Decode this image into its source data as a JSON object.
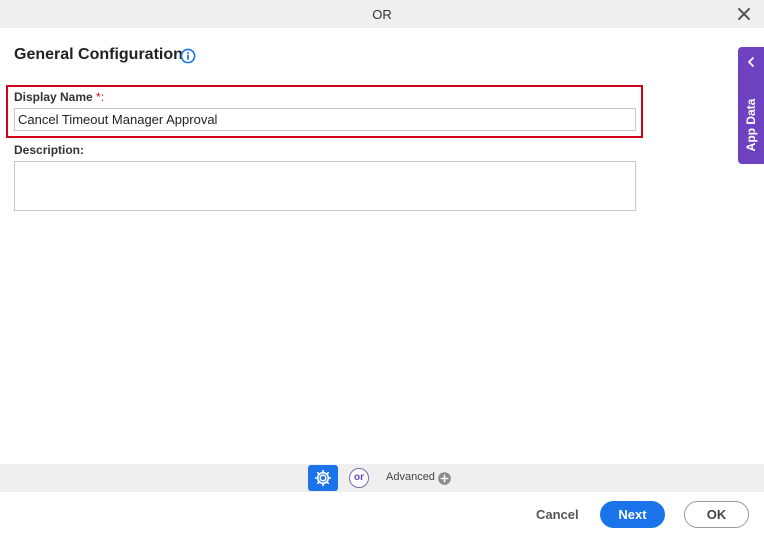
{
  "window": {
    "title": "OR"
  },
  "form": {
    "heading": "General Configuration",
    "display_name": {
      "label": "Display Name",
      "required_mark": "*:",
      "value": "Cancel Timeout Manager Approval"
    },
    "description": {
      "label": "Description:",
      "value": ""
    }
  },
  "side_panel": {
    "label": "App Data"
  },
  "bottom_tabs": {
    "or_label": "or",
    "advanced_label": "Advanced"
  },
  "footer": {
    "cancel_label": "Cancel",
    "next_label": "Next",
    "ok_label": "OK"
  },
  "colors": {
    "primary": "#1a73e8",
    "accent": "#6f42c1",
    "highlight": "#d0021b"
  },
  "icons": [
    "close-icon",
    "info-icon",
    "chevron-left-icon",
    "gear-icon",
    "plus-circle-icon"
  ]
}
